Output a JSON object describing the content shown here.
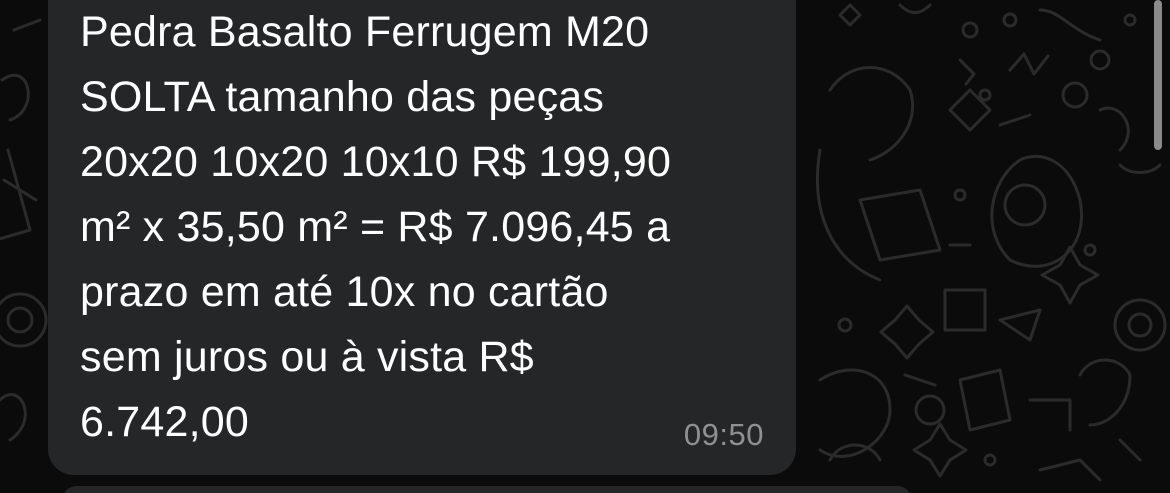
{
  "conversation": {
    "message": {
      "text": "Pedra Basalto Ferrugem M20\nSOLTA tamanho das peças\n20x20 10x20 10x10 R$ 199,90\nm² x 35,50 m² = R$ 7.096,45 a\nprazo em até 10x no cartão\nsem juros ou à vista R$\n6.742,00",
      "time": "09:50"
    }
  },
  "theme": {
    "background": "#0b0b0b",
    "bubble": "#242627",
    "text": "#ffffff",
    "timestamp": "#8e9192",
    "doodle_stroke": "#2a2a2a"
  }
}
